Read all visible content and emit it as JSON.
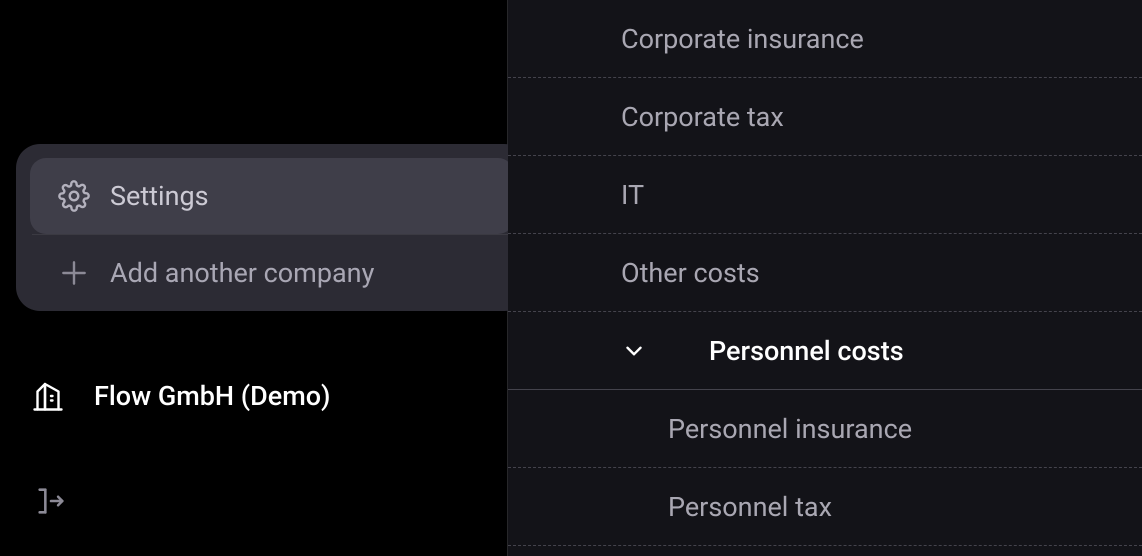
{
  "popover": {
    "settings_label": "Settings",
    "add_company_label": "Add another company"
  },
  "company": {
    "name": "Flow GmbH (Demo)"
  },
  "categories": {
    "items": [
      {
        "label": "Corporate insurance",
        "type": "row"
      },
      {
        "label": "Corporate tax",
        "type": "row"
      },
      {
        "label": "IT",
        "type": "row"
      },
      {
        "label": "Other costs",
        "type": "row"
      },
      {
        "label": "Personnel costs",
        "type": "expandable"
      },
      {
        "label": "Personnel insurance",
        "type": "sub"
      },
      {
        "label": "Personnel tax",
        "type": "sub"
      }
    ]
  },
  "colors": {
    "bg": "#000000",
    "panel": "#131318",
    "popover": "#2c2b34",
    "popover_active": "#3f3e49",
    "text_muted": "#a9a7b2",
    "text_primary": "#ffffff",
    "divider": "#44434c"
  }
}
